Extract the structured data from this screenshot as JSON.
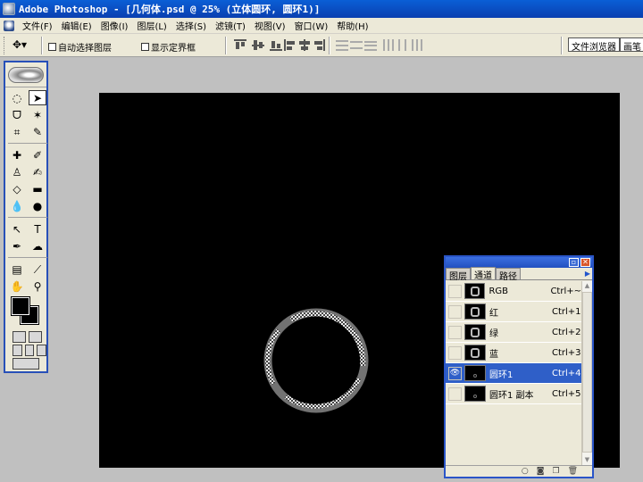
{
  "window": {
    "title": "Adobe Photoshop - [几何体.psd @ 25% (立体圆环, 圆环1)]"
  },
  "menu": [
    "文件(F)",
    "编辑(E)",
    "图像(I)",
    "图层(L)",
    "选择(S)",
    "滤镜(T)",
    "视图(V)",
    "窗口(W)",
    "帮助(H)"
  ],
  "options": {
    "auto_select_label": "自动选择图层",
    "show_bounds_label": "显示定界框"
  },
  "tabs": {
    "file_browser": "文件浏览器",
    "brushes": "画笔"
  },
  "channels_panel": {
    "tabs": [
      "图层",
      "通道",
      "路径"
    ],
    "active_tab": "通道",
    "rows": [
      {
        "name": "RGB",
        "shortcut": "Ctrl+~",
        "visible": false,
        "selected": false,
        "thumb": "image"
      },
      {
        "name": "红",
        "shortcut": "Ctrl+1",
        "visible": false,
        "selected": false,
        "thumb": "image"
      },
      {
        "name": "绿",
        "shortcut": "Ctrl+2",
        "visible": false,
        "selected": false,
        "thumb": "image"
      },
      {
        "name": "蓝",
        "shortcut": "Ctrl+3",
        "visible": false,
        "selected": false,
        "thumb": "image"
      },
      {
        "name": "圆环1",
        "shortcut": "Ctrl+4",
        "visible": true,
        "selected": true,
        "thumb": "mask"
      },
      {
        "name": "圆环1 副本",
        "shortcut": "Ctrl+5",
        "visible": false,
        "selected": false,
        "thumb": "mask"
      }
    ]
  },
  "colors": {
    "foreground": "#000000",
    "background": "#000000",
    "canvas": "#000000",
    "selection_accent": "#2f5fc8"
  }
}
